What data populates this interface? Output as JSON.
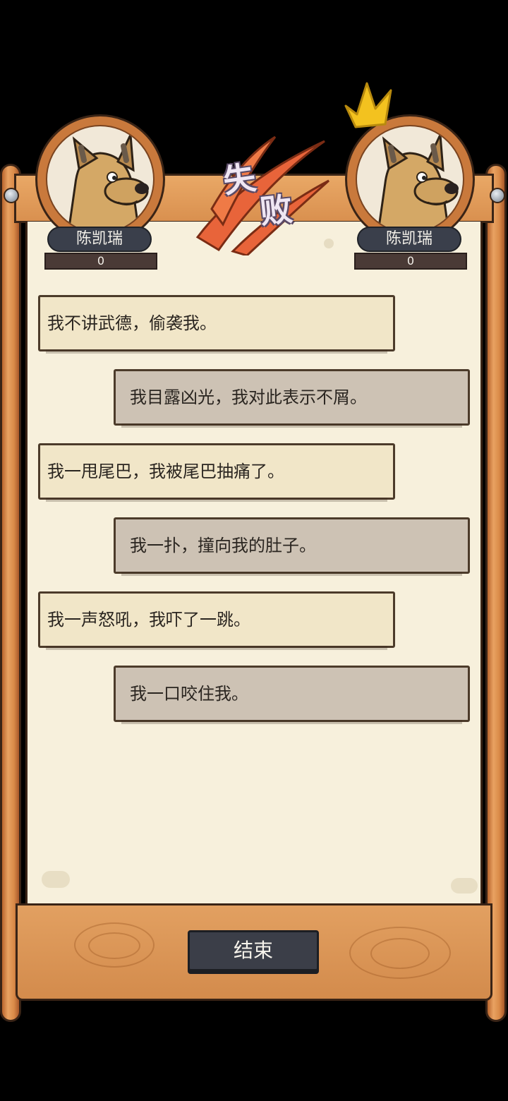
{
  "players": [
    {
      "name": "陈凯瑞",
      "score": "0",
      "crown": false
    },
    {
      "name": "陈凯瑞",
      "score": "0",
      "crown": true
    }
  ],
  "result": {
    "char1": "失",
    "char2": "败",
    "color": "#e8643a"
  },
  "messages": [
    {
      "side": "left",
      "text": "我不讲武德，偷袭我。"
    },
    {
      "side": "right",
      "text": "我目露凶光，我对此表示不屑。"
    },
    {
      "side": "left",
      "text": "我一甩尾巴，我被尾巴抽痛了。"
    },
    {
      "side": "right",
      "text": "我一扑，撞向我的肚子。"
    },
    {
      "side": "left",
      "text": "我一声怒吼，我吓了一跳。"
    },
    {
      "side": "right",
      "text": "我一口咬住我。"
    }
  ],
  "end_button": {
    "label": "结束"
  },
  "icons": {
    "avatar": "dog-avatar-icon",
    "crown": "crown-icon",
    "bolt": "bolt-icon"
  }
}
